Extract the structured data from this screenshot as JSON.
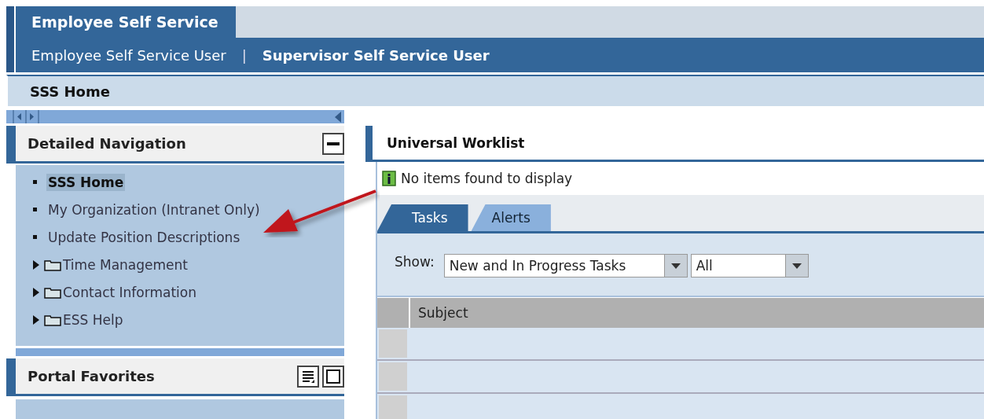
{
  "top_tabs": [
    {
      "label": "Employee Self Service",
      "selected": true
    }
  ],
  "sub_links": [
    {
      "label": "Employee Self Service User",
      "selected": false
    },
    {
      "label": "Supervisor Self Service User",
      "selected": true
    }
  ],
  "separator": "|",
  "breadcrumb": "SSS Home",
  "detailed_navigation": {
    "title": "Detailed Navigation",
    "items": [
      {
        "kind": "page",
        "label": "SSS Home",
        "selected": true
      },
      {
        "kind": "page",
        "label": "My Organization (Intranet Only)",
        "selected": false
      },
      {
        "kind": "page",
        "label": "Update Position Descriptions",
        "selected": false
      },
      {
        "kind": "folder",
        "label": "Time Management",
        "expanded": false
      },
      {
        "kind": "folder",
        "label": "Contact Information",
        "expanded": false
      },
      {
        "kind": "folder",
        "label": "ESS Help",
        "expanded": false
      }
    ]
  },
  "portal_favorites": {
    "title": "Portal Favorites"
  },
  "worklist": {
    "title": "Universal Worklist",
    "message": "No items found to display",
    "tabs": [
      {
        "label": "Tasks",
        "selected": true
      },
      {
        "label": "Alerts",
        "selected": false
      }
    ],
    "filter": {
      "label": "Show:",
      "selects": [
        {
          "value": "New and In Progress Tasks"
        },
        {
          "value": "All"
        }
      ]
    },
    "table": {
      "columns": [
        "Subject"
      ]
    }
  }
}
